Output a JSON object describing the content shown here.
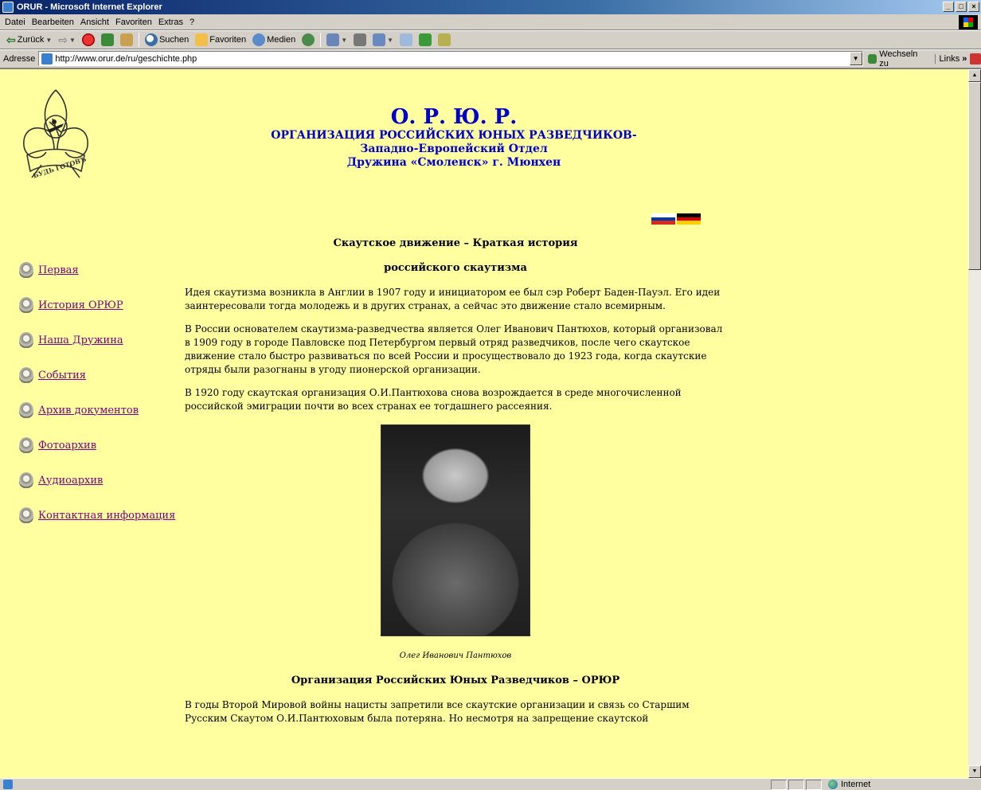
{
  "window": {
    "title": "ORUR - Microsoft Internet Explorer",
    "controls": [
      "minimize",
      "maximize",
      "close"
    ]
  },
  "menu": [
    "Datei",
    "Bearbeiten",
    "Ansicht",
    "Favoriten",
    "Extras",
    "?"
  ],
  "toolbar": {
    "back": "Zurück",
    "search": "Suchen",
    "favorites": "Favoriten",
    "media": "Medien"
  },
  "addressbar": {
    "label": "Adresse",
    "url": "http://www.orur.de/ru/geschichte.php",
    "go": "Wechseln zu",
    "links": "Links"
  },
  "header": {
    "abbr": "О. Р. Ю. Р.",
    "org": "ОРГАНИЗАЦИЯ РОССИЙСКИХ ЮНЫХ РАЗВЕДЧИКОВ-",
    "dept": "Западно-Европейский Отдел",
    "unit": "Дружина «Смоленск» г. Мюнхен"
  },
  "logo": {
    "motto": "БУДЬ ГОТОВЪ"
  },
  "flags": [
    "russian-flag",
    "german-flag"
  ],
  "nav": [
    "Первая",
    "История ОРЮР",
    "Наша Дружина",
    "События",
    "Архив документов",
    "Фотоархив",
    "Аудиоархив",
    "Контактная информация"
  ],
  "content": {
    "title1": "Скаутское движение – Краткая история",
    "title2": "российского скаутизма",
    "p1": "Идея скаутизма возникла в Англии в 1907 году и инициатором ее был сэр Роберт Баден-Пауэл. Его идеи заинтересовали тогда молодежь и в других странах, а сейчас это движение стало всемирным.",
    "p2": "В России основателем скаутизма-разведчества является Олег Иванович Пантюхов, который организовал в 1909 году в городе Павловске под Петербургом первый отряд разведчиков, после чего скаутское движение стало быстро развиваться по всей России и просуществовало до 1923 года, когда скаутские отряды были разогнаны в угоду пионерской организации.",
    "p3": "В 1920 году скаутская организация О.И.Пантюхова снова возрождается в среде многочисленной российской эмиграции почти во всех странах ее тогдашнего рассеяния.",
    "caption": "Олег Иванович Пантюхов",
    "title3": "Организация Российских Юных Разведчиков – ОРЮР",
    "p4": "В годы Второй Мировой войны нацисты запретили все скаутские организации и связь со Старшим Русским Скаутом О.И.Пантюховым была потеряна. Но несмотря на запрещение скаутской"
  },
  "status": {
    "zone": "Internet"
  }
}
